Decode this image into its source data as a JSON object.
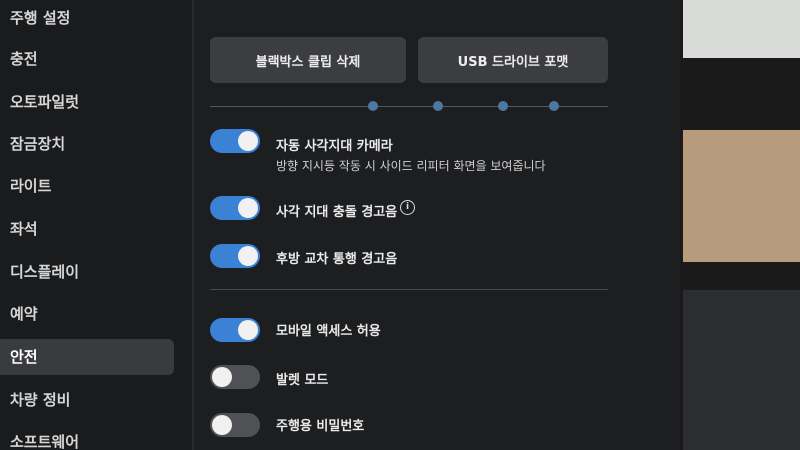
{
  "sidebar": {
    "items": [
      {
        "label": "주행 설정"
      },
      {
        "label": "충전"
      },
      {
        "label": "오토파일럿"
      },
      {
        "label": "잠금장치"
      },
      {
        "label": "라이트"
      },
      {
        "label": "좌석"
      },
      {
        "label": "디스플레이"
      },
      {
        "label": "예약"
      },
      {
        "label": "안전"
      },
      {
        "label": "차량 정비"
      },
      {
        "label": "소프트웨어"
      }
    ],
    "active": "안전"
  },
  "buttons": {
    "dashcam_delete": "블랙박스 클립 삭제",
    "usb_format": "USB 드라이브 포맷"
  },
  "settings": {
    "blind_spot_camera": {
      "label": "자동 사각지대 카메라",
      "description": "방향 지시등 작동 시 사이드 리피터 화면을 보여줍니다",
      "enabled": true
    },
    "blind_spot_chime": {
      "label": "사각 지대 충돌 경고음",
      "info_icon": "i",
      "enabled": true
    },
    "rear_cross_traffic": {
      "label": "후방 교차 통행 경고음",
      "enabled": true
    },
    "mobile_access": {
      "label": "모바일 액세스 허용",
      "enabled": true
    },
    "valet_mode": {
      "label": "발렛 모드",
      "enabled": false
    },
    "pin_to_drive": {
      "label": "주행용 비밀번호",
      "enabled": false
    }
  },
  "colors": {
    "toggle_on": "#3b82d6",
    "toggle_off": "#505154",
    "active_nav_bg": "#3a3b3e"
  },
  "icons": [
    "info-icon",
    "toggle-knob"
  ]
}
